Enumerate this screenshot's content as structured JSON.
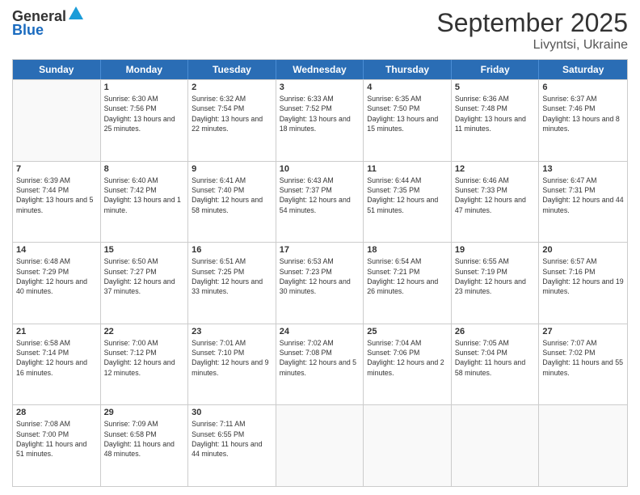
{
  "logo": {
    "general": "General",
    "blue": "Blue"
  },
  "title": "September 2025",
  "subtitle": "Livyntsi, Ukraine",
  "days": [
    "Sunday",
    "Monday",
    "Tuesday",
    "Wednesday",
    "Thursday",
    "Friday",
    "Saturday"
  ],
  "rows": [
    [
      {
        "day": "",
        "sunrise": "",
        "sunset": "",
        "daylight": "",
        "empty": true
      },
      {
        "day": "1",
        "sunrise": "Sunrise: 6:30 AM",
        "sunset": "Sunset: 7:56 PM",
        "daylight": "Daylight: 13 hours and 25 minutes."
      },
      {
        "day": "2",
        "sunrise": "Sunrise: 6:32 AM",
        "sunset": "Sunset: 7:54 PM",
        "daylight": "Daylight: 13 hours and 22 minutes."
      },
      {
        "day": "3",
        "sunrise": "Sunrise: 6:33 AM",
        "sunset": "Sunset: 7:52 PM",
        "daylight": "Daylight: 13 hours and 18 minutes."
      },
      {
        "day": "4",
        "sunrise": "Sunrise: 6:35 AM",
        "sunset": "Sunset: 7:50 PM",
        "daylight": "Daylight: 13 hours and 15 minutes."
      },
      {
        "day": "5",
        "sunrise": "Sunrise: 6:36 AM",
        "sunset": "Sunset: 7:48 PM",
        "daylight": "Daylight: 13 hours and 11 minutes."
      },
      {
        "day": "6",
        "sunrise": "Sunrise: 6:37 AM",
        "sunset": "Sunset: 7:46 PM",
        "daylight": "Daylight: 13 hours and 8 minutes."
      }
    ],
    [
      {
        "day": "7",
        "sunrise": "Sunrise: 6:39 AM",
        "sunset": "Sunset: 7:44 PM",
        "daylight": "Daylight: 13 hours and 5 minutes."
      },
      {
        "day": "8",
        "sunrise": "Sunrise: 6:40 AM",
        "sunset": "Sunset: 7:42 PM",
        "daylight": "Daylight: 13 hours and 1 minute."
      },
      {
        "day": "9",
        "sunrise": "Sunrise: 6:41 AM",
        "sunset": "Sunset: 7:40 PM",
        "daylight": "Daylight: 12 hours and 58 minutes."
      },
      {
        "day": "10",
        "sunrise": "Sunrise: 6:43 AM",
        "sunset": "Sunset: 7:37 PM",
        "daylight": "Daylight: 12 hours and 54 minutes."
      },
      {
        "day": "11",
        "sunrise": "Sunrise: 6:44 AM",
        "sunset": "Sunset: 7:35 PM",
        "daylight": "Daylight: 12 hours and 51 minutes."
      },
      {
        "day": "12",
        "sunrise": "Sunrise: 6:46 AM",
        "sunset": "Sunset: 7:33 PM",
        "daylight": "Daylight: 12 hours and 47 minutes."
      },
      {
        "day": "13",
        "sunrise": "Sunrise: 6:47 AM",
        "sunset": "Sunset: 7:31 PM",
        "daylight": "Daylight: 12 hours and 44 minutes."
      }
    ],
    [
      {
        "day": "14",
        "sunrise": "Sunrise: 6:48 AM",
        "sunset": "Sunset: 7:29 PM",
        "daylight": "Daylight: 12 hours and 40 minutes."
      },
      {
        "day": "15",
        "sunrise": "Sunrise: 6:50 AM",
        "sunset": "Sunset: 7:27 PM",
        "daylight": "Daylight: 12 hours and 37 minutes."
      },
      {
        "day": "16",
        "sunrise": "Sunrise: 6:51 AM",
        "sunset": "Sunset: 7:25 PM",
        "daylight": "Daylight: 12 hours and 33 minutes."
      },
      {
        "day": "17",
        "sunrise": "Sunrise: 6:53 AM",
        "sunset": "Sunset: 7:23 PM",
        "daylight": "Daylight: 12 hours and 30 minutes."
      },
      {
        "day": "18",
        "sunrise": "Sunrise: 6:54 AM",
        "sunset": "Sunset: 7:21 PM",
        "daylight": "Daylight: 12 hours and 26 minutes."
      },
      {
        "day": "19",
        "sunrise": "Sunrise: 6:55 AM",
        "sunset": "Sunset: 7:19 PM",
        "daylight": "Daylight: 12 hours and 23 minutes."
      },
      {
        "day": "20",
        "sunrise": "Sunrise: 6:57 AM",
        "sunset": "Sunset: 7:16 PM",
        "daylight": "Daylight: 12 hours and 19 minutes."
      }
    ],
    [
      {
        "day": "21",
        "sunrise": "Sunrise: 6:58 AM",
        "sunset": "Sunset: 7:14 PM",
        "daylight": "Daylight: 12 hours and 16 minutes."
      },
      {
        "day": "22",
        "sunrise": "Sunrise: 7:00 AM",
        "sunset": "Sunset: 7:12 PM",
        "daylight": "Daylight: 12 hours and 12 minutes."
      },
      {
        "day": "23",
        "sunrise": "Sunrise: 7:01 AM",
        "sunset": "Sunset: 7:10 PM",
        "daylight": "Daylight: 12 hours and 9 minutes."
      },
      {
        "day": "24",
        "sunrise": "Sunrise: 7:02 AM",
        "sunset": "Sunset: 7:08 PM",
        "daylight": "Daylight: 12 hours and 5 minutes."
      },
      {
        "day": "25",
        "sunrise": "Sunrise: 7:04 AM",
        "sunset": "Sunset: 7:06 PM",
        "daylight": "Daylight: 12 hours and 2 minutes."
      },
      {
        "day": "26",
        "sunrise": "Sunrise: 7:05 AM",
        "sunset": "Sunset: 7:04 PM",
        "daylight": "Daylight: 11 hours and 58 minutes."
      },
      {
        "day": "27",
        "sunrise": "Sunrise: 7:07 AM",
        "sunset": "Sunset: 7:02 PM",
        "daylight": "Daylight: 11 hours and 55 minutes."
      }
    ],
    [
      {
        "day": "28",
        "sunrise": "Sunrise: 7:08 AM",
        "sunset": "Sunset: 7:00 PM",
        "daylight": "Daylight: 11 hours and 51 minutes."
      },
      {
        "day": "29",
        "sunrise": "Sunrise: 7:09 AM",
        "sunset": "Sunset: 6:58 PM",
        "daylight": "Daylight: 11 hours and 48 minutes."
      },
      {
        "day": "30",
        "sunrise": "Sunrise: 7:11 AM",
        "sunset": "Sunset: 6:55 PM",
        "daylight": "Daylight: 11 hours and 44 minutes."
      },
      {
        "day": "",
        "sunrise": "",
        "sunset": "",
        "daylight": "",
        "empty": true
      },
      {
        "day": "",
        "sunrise": "",
        "sunset": "",
        "daylight": "",
        "empty": true
      },
      {
        "day": "",
        "sunrise": "",
        "sunset": "",
        "daylight": "",
        "empty": true
      },
      {
        "day": "",
        "sunrise": "",
        "sunset": "",
        "daylight": "",
        "empty": true
      }
    ]
  ]
}
